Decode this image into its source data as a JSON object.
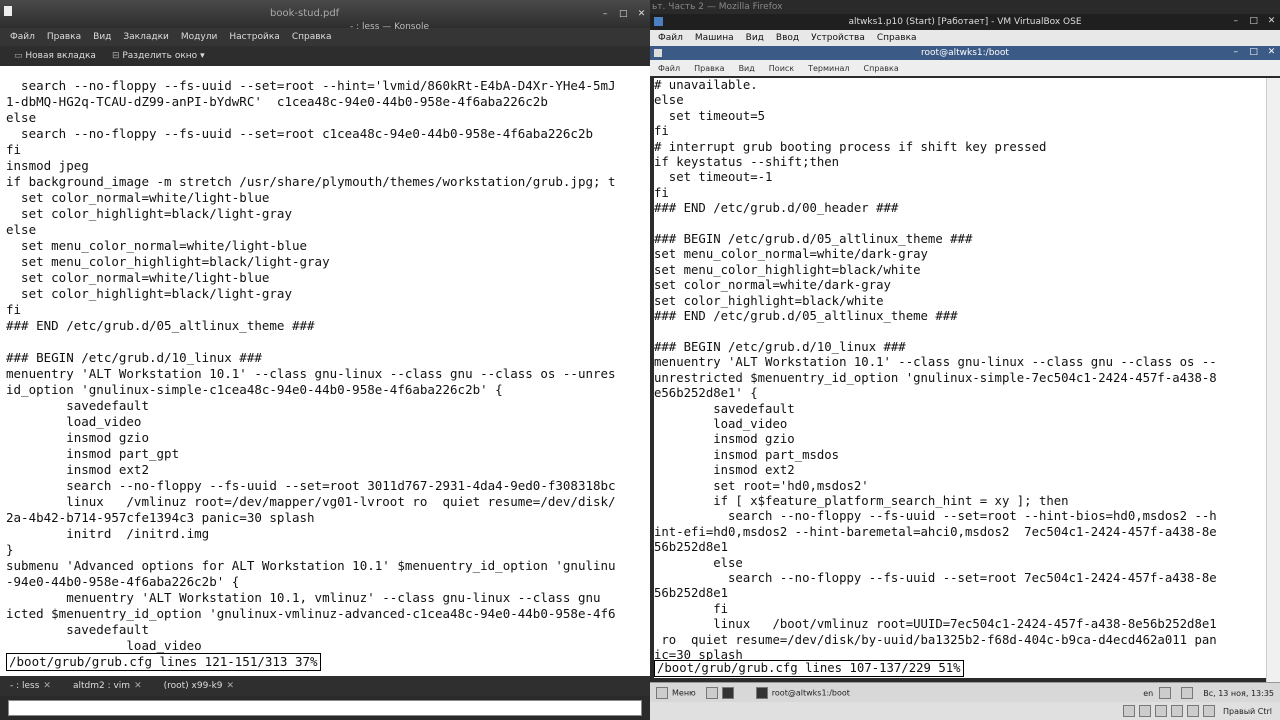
{
  "left": {
    "pdf_title": "book-stud.pdf",
    "window_title": "- : less — Konsole",
    "menu": [
      "Файл",
      "Правка",
      "Вид",
      "Закладки",
      "Модули",
      "Настройка",
      "Справка"
    ],
    "toolbar": {
      "new_tab": "Новая вкладка",
      "split": "Разделить окно"
    },
    "lines": [
      "  search --no-floppy --fs-uuid --set=root --hint='lvmid/860kRt-E4bA-D4Xr-YHe4-5mJ",
      "1-dbMQ-HG2q-TCAU-dZ99-anPI-bYdwRC'  c1cea48c-94e0-44b0-958e-4f6aba226c2b",
      "else",
      "  search --no-floppy --fs-uuid --set=root c1cea48c-94e0-44b0-958e-4f6aba226c2b",
      "fi",
      "insmod jpeg",
      "if background_image -m stretch /usr/share/plymouth/themes/workstation/grub.jpg; t",
      "  set color_normal=white/light-blue",
      "  set color_highlight=black/light-gray",
      "else",
      "  set menu_color_normal=white/light-blue",
      "  set menu_color_highlight=black/light-gray",
      "  set color_normal=white/light-blue",
      "  set color_highlight=black/light-gray",
      "fi",
      "### END /etc/grub.d/05_altlinux_theme ###",
      "",
      "### BEGIN /etc/grub.d/10_linux ###",
      "menuentry 'ALT Workstation 10.1' --class gnu-linux --class gnu --class os --unres",
      "id_option 'gnulinux-simple-c1cea48c-94e0-44b0-958e-4f6aba226c2b' {",
      "        savedefault",
      "        load_video",
      "        insmod gzio",
      "        insmod part_gpt",
      "        insmod ext2",
      "        search --no-floppy --fs-uuid --set=root 3011d767-2931-4da4-9ed0-f308318bc",
      "        linux   /vmlinuz root=/dev/mapper/vg01-lvroot ro  quiet resume=/dev/disk/",
      "2a-4b42-b714-957cfe1394c3 panic=30 splash",
      "        initrd  /initrd.img",
      "}",
      "submenu 'Advanced options for ALT Workstation 10.1' $menuentry_id_option 'gnulinu",
      "-94e0-44b0-958e-4f6aba226c2b' {",
      "        menuentry 'ALT Workstation 10.1, vmlinuz' --class gnu-linux --class gnu",
      "icted $menuentry_id_option 'gnulinux-vmlinuz-advanced-c1cea48c-94e0-44b0-958e-4f6",
      "        savedefault",
      "                load_video"
    ],
    "status": "/boot/grub/grub.cfg lines 121-151/313 37%",
    "tabs": [
      "- : less",
      "altdm2 : vim",
      "(root) x99-k9"
    ]
  },
  "right": {
    "firefox_title": "ьт. Часть 2 — Mozilla Firefox",
    "vbox_title": "altwks1.p10 (Start) [Работает] - VM VirtualBox OSE",
    "vbox_menu": [
      "Файл",
      "Машина",
      "Вид",
      "Ввод",
      "Устройства",
      "Справка"
    ],
    "inner_title": "root@altwks1:/boot",
    "inner_menu": [
      "Файл",
      "Правка",
      "Вид",
      "Поиск",
      "Терминал",
      "Справка"
    ],
    "lines": [
      "# unavailable.",
      "else",
      "  set timeout=5",
      "fi",
      "# interrupt grub booting process if shift key pressed",
      "if keystatus --shift;then",
      "  set timeout=-1",
      "fi",
      "### END /etc/grub.d/00_header ###",
      "",
      "### BEGIN /etc/grub.d/05_altlinux_theme ###",
      "set menu_color_normal=white/dark-gray",
      "set menu_color_highlight=black/white",
      "set color_normal=white/dark-gray",
      "set color_highlight=black/white",
      "### END /etc/grub.d/05_altlinux_theme ###",
      "",
      "### BEGIN /etc/grub.d/10_linux ###",
      "menuentry 'ALT Workstation 10.1' --class gnu-linux --class gnu --class os --",
      "unrestricted $menuentry_id_option 'gnulinux-simple-7ec504c1-2424-457f-a438-8",
      "e56b252d8e1' {",
      "        savedefault",
      "        load_video",
      "        insmod gzio",
      "        insmod part_msdos",
      "        insmod ext2",
      "        set root='hd0,msdos2'",
      "        if [ x$feature_platform_search_hint = xy ]; then",
      "          search --no-floppy --fs-uuid --set=root --hint-bios=hd0,msdos2 --h",
      "int-efi=hd0,msdos2 --hint-baremetal=ahci0,msdos2  7ec504c1-2424-457f-a438-8e",
      "56b252d8e1",
      "        else",
      "          search --no-floppy --fs-uuid --set=root 7ec504c1-2424-457f-a438-8e",
      "56b252d8e1",
      "        fi",
      "        linux   /boot/vmlinuz root=UUID=7ec504c1-2424-457f-a438-8e56b252d8e1",
      " ro  quiet resume=/dev/disk/by-uuid/ba1325b2-f68d-404c-b9ca-d4ecd462a011 pan",
      "ic=30 splash"
    ],
    "status": "/boot/grub/grub.cfg lines 107-137/229 51%",
    "taskbar": {
      "menu": "Меню",
      "task": "root@altwks1:/boot",
      "lang": "en",
      "clock": "Вс, 13 ноя, 13:35"
    },
    "vbox_status": "Правый Ctrl"
  }
}
